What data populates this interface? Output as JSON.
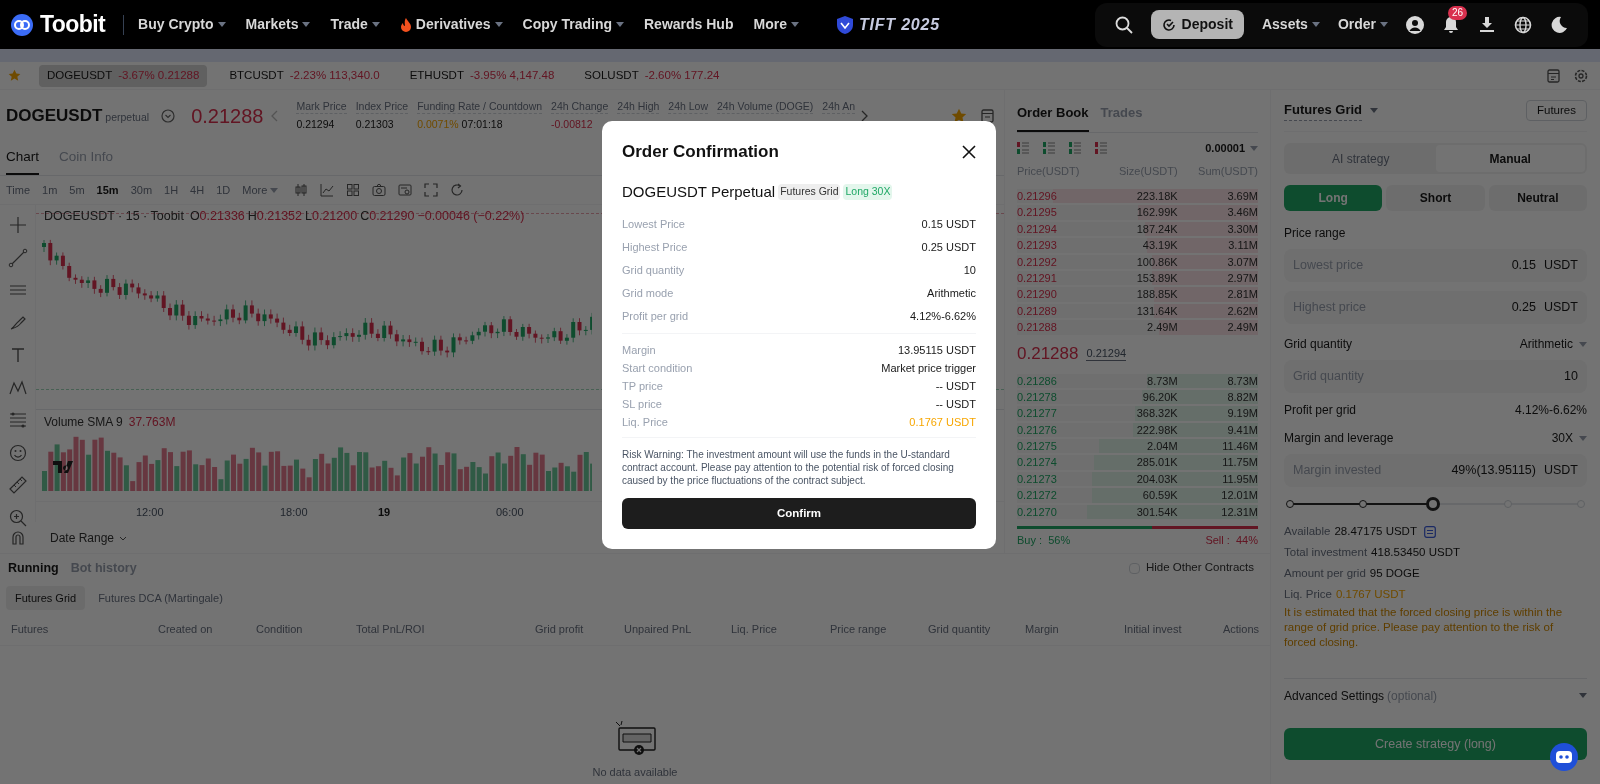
{
  "nav": {
    "brand": "Toobit",
    "items": [
      {
        "label": "Buy Crypto",
        "dropdown": true,
        "hot": false
      },
      {
        "label": "Markets",
        "dropdown": true,
        "hot": false
      },
      {
        "label": "Trade",
        "dropdown": true,
        "hot": false
      },
      {
        "label": "Derivatives",
        "dropdown": true,
        "hot": true
      },
      {
        "label": "Copy Trading",
        "dropdown": true,
        "hot": false
      },
      {
        "label": "Rewards Hub",
        "dropdown": false,
        "hot": false
      },
      {
        "label": "More",
        "dropdown": true,
        "hot": false
      }
    ],
    "event_logo": "TIFT 2025",
    "deposit": "Deposit",
    "menus": [
      {
        "label": "Assets"
      },
      {
        "label": "Order"
      }
    ],
    "notification_count": "26"
  },
  "tickers": [
    {
      "symbol": "DOGEUSDT",
      "change": "-3.67%",
      "price": "0.21288",
      "selected": true
    },
    {
      "symbol": "BTCUSDT",
      "change": "-2.23%",
      "price": "113,340.0",
      "selected": false
    },
    {
      "symbol": "ETHUSDT",
      "change": "-3.95%",
      "price": "4,147.48",
      "selected": false
    },
    {
      "symbol": "SOLUSDT",
      "change": "-2.60%",
      "price": "177.24",
      "selected": false
    }
  ],
  "symbol_header": {
    "symbol": "DOGEUSDT",
    "type": "perpetual",
    "price": "0.21288",
    "stats": [
      {
        "label": "Mark Price",
        "values": [
          {
            "text": "0.21294",
            "kind": "plain"
          }
        ]
      },
      {
        "label": "Index Price",
        "values": [
          {
            "text": "0.21303",
            "kind": "plain"
          }
        ]
      },
      {
        "label": "Funding Rate / Countdown",
        "values": [
          {
            "text": "0.0071%",
            "kind": "warn"
          },
          {
            "text": "07:01:18",
            "kind": "plain"
          }
        ]
      },
      {
        "label": "24h Change",
        "values": [
          {
            "text": "-0.00812",
            "kind": "down"
          }
        ]
      },
      {
        "label": "24h High"
      },
      {
        "label": "24h Low"
      },
      {
        "label": "24h Volume (DOGE)"
      },
      {
        "label": "24h An"
      }
    ]
  },
  "chart_tabs": [
    {
      "label": "Chart",
      "selected": true
    },
    {
      "label": "Coin Info",
      "selected": false
    }
  ],
  "intervals": [
    {
      "label": "Time",
      "selected": false
    },
    {
      "label": "1m",
      "selected": false
    },
    {
      "label": "5m",
      "selected": false
    },
    {
      "label": "15m",
      "selected": true
    },
    {
      "label": "30m",
      "selected": false
    },
    {
      "label": "1H",
      "selected": false
    },
    {
      "label": "4H",
      "selected": false
    },
    {
      "label": "1D",
      "selected": false
    }
  ],
  "more_intervals": "More",
  "chart": {
    "legend_title": "DOGEUSDT · 15 · Toobit",
    "ohlc": [
      {
        "key": "O",
        "value": "0.21336"
      },
      {
        "key": "H",
        "value": "0.21352"
      },
      {
        "key": "L",
        "value": "0.21200"
      },
      {
        "key": "C",
        "value": "0.21290"
      }
    ],
    "change": "−0.00046 (−0.22%)",
    "volume_label": "Volume SMA 9",
    "volume_value": "37.763M",
    "time_labels": [
      {
        "label": "12:00",
        "day": false
      },
      {
        "label": "18:00",
        "day": false
      },
      {
        "label": "19",
        "day": true
      },
      {
        "label": "06:00",
        "day": false
      }
    ],
    "date_range": "Date Range"
  },
  "order_book": {
    "tabs": [
      {
        "label": "Order Book",
        "selected": true
      },
      {
        "label": "Trades",
        "selected": false
      }
    ],
    "precision": "0.00001",
    "columns": [
      "Price(USDT)",
      "Size(USDT)",
      "Sum(USDT)"
    ],
    "asks": [
      {
        "price": "0.21296",
        "size": "223.18K",
        "sum": "3.69M",
        "level": 0.85
      },
      {
        "price": "0.21295",
        "size": "162.99K",
        "sum": "3.46M",
        "level": 0.5
      },
      {
        "price": "0.21294",
        "size": "187.24K",
        "sum": "3.30M",
        "level": 0.47
      },
      {
        "price": "0.21293",
        "size": "43.19K",
        "sum": "3.11M",
        "level": 0.46
      },
      {
        "price": "0.21292",
        "size": "100.86K",
        "sum": "3.07M",
        "level": 0.44
      },
      {
        "price": "0.21291",
        "size": "153.89K",
        "sum": "2.97M",
        "level": 0.44
      },
      {
        "price": "0.21290",
        "size": "188.85K",
        "sum": "2.81M",
        "level": 0.43
      },
      {
        "price": "0.21289",
        "size": "131.64K",
        "sum": "2.62M",
        "level": 0.43
      },
      {
        "price": "0.21288",
        "size": "2.49M",
        "sum": "2.49M",
        "level": 0.41
      }
    ],
    "last_price": "0.21288",
    "mark_price": "0.21294",
    "bids": [
      {
        "price": "0.21286",
        "size": "8.73M",
        "sum": "8.73M",
        "level": 0.46
      },
      {
        "price": "0.21278",
        "size": "96.20K",
        "sum": "8.82M",
        "level": 0.48
      },
      {
        "price": "0.21277",
        "size": "368.32K",
        "sum": "9.19M",
        "level": 0.51
      },
      {
        "price": "0.21276",
        "size": "222.98K",
        "sum": "9.41M",
        "level": 0.52
      },
      {
        "price": "0.21275",
        "size": "2.04M",
        "sum": "11.46M",
        "level": 0.66
      },
      {
        "price": "0.21274",
        "size": "285.01K",
        "sum": "11.75M",
        "level": 0.68
      },
      {
        "price": "0.21273",
        "size": "204.03K",
        "sum": "11.95M",
        "level": 0.69
      },
      {
        "price": "0.21272",
        "size": "60.59K",
        "sum": "12.01M",
        "level": 0.69
      },
      {
        "price": "0.21270",
        "size": "301.54K",
        "sum": "12.31M",
        "level": 0.71
      }
    ],
    "balance": {
      "level": 0.56,
      "buy": "Buy :  56%",
      "sell": "Sell :  44%"
    }
  },
  "bots": {
    "tabs": [
      {
        "label": "Running",
        "selected": true
      },
      {
        "label": "Bot history",
        "selected": false
      }
    ],
    "hide_other": {
      "label": "Hide Other Contracts",
      "checked": false
    },
    "sub_tabs": [
      {
        "label": "Futures Grid",
        "selected": true
      },
      {
        "label": "Futures DCA (Martingale)",
        "selected": false
      }
    ],
    "columns": [
      "Futures",
      "Created on",
      "Condition",
      "Total PnL/ROI",
      "Grid profit",
      "Unpaired PnL",
      "Liq. Price",
      "Price range",
      "Grid quantity",
      "Margin",
      "Initial invest",
      "Actions"
    ],
    "empty": "No data available"
  },
  "strategy_panel": {
    "title": "Futures Grid",
    "market_button": "Futures",
    "modes": [
      {
        "label": "AI strategy",
        "selected": false
      },
      {
        "label": "Manual",
        "selected": true
      }
    ],
    "directions": [
      {
        "label": "Long",
        "selected": true
      },
      {
        "label": "Short",
        "selected": false
      },
      {
        "label": "Neutral",
        "selected": false
      }
    ],
    "price_range_label": "Price range",
    "price_fields": [
      {
        "placeholder": "Lowest price",
        "value": "0.15",
        "unit": "USDT"
      },
      {
        "placeholder": "Highest price",
        "value": "0.25",
        "unit": "USDT"
      }
    ],
    "grid_label": "Grid quantity",
    "grid_mode": "Arithmetic",
    "grid_field": {
      "placeholder": "Grid quantity",
      "value": "10"
    },
    "profit_label": "Profit per grid",
    "profit_value": "4.12%-6.62%",
    "margin_label": "Margin and leverage",
    "leverage": "30X",
    "margin_field": {
      "placeholder": "Margin invested",
      "value": "49%(13.95115)",
      "unit": "USDT"
    },
    "margin_slider": {
      "level": 0.49
    },
    "summary": [
      {
        "label": "Available",
        "value": "28.47175 USDT",
        "kind": "plain",
        "transfer": true
      },
      {
        "label": "Total investment",
        "value": "418.53450 USDT",
        "kind": "plain",
        "transfer": false
      },
      {
        "label": "Amount per grid",
        "value": "95 DOGE",
        "kind": "plain",
        "transfer": false
      },
      {
        "label": "Liq. Price",
        "value": "0.1767 USDT",
        "kind": "warn",
        "transfer": false
      }
    ],
    "liq_warning": "It is estimated that the forced closing price is within the range of grid price. Please pay attention to the risk of forced closing.",
    "advanced": "Advanced Settings",
    "advanced_note": "(optional)",
    "create": "Create strategy (long)"
  },
  "modal": {
    "title": "Order Confirmation",
    "symbol": "DOGEUSDT Perpetual",
    "tags": [
      {
        "label": "Futures Grid",
        "kind": "neutral"
      },
      {
        "label": "Long 30X",
        "kind": "long"
      }
    ],
    "groups": [
      [
        {
          "label": "Lowest Price",
          "value": "0.15 USDT",
          "kind": "plain"
        },
        {
          "label": "Highest Price",
          "value": "0.25 USDT",
          "kind": "plain"
        },
        {
          "label": "Grid quantity",
          "value": "10",
          "kind": "plain"
        },
        {
          "label": "Grid mode",
          "value": "Arithmetic",
          "kind": "plain"
        },
        {
          "label": "Profit per grid",
          "value": "4.12%-6.62%",
          "kind": "plain"
        }
      ],
      [
        {
          "label": "Margin",
          "value": "13.95115 USDT",
          "kind": "plain"
        },
        {
          "label": "Start condition",
          "value": "Market price trigger",
          "kind": "plain"
        },
        {
          "label": "TP price",
          "value": "-- USDT",
          "kind": "plain"
        },
        {
          "label": "SL price",
          "value": "-- USDT",
          "kind": "plain"
        },
        {
          "label": "Liq. Price",
          "value": "0.1767 USDT",
          "kind": "warn"
        }
      ]
    ],
    "warning": "Risk Warning: The investment amount will use the funds in the U-standard contract account. Please pay attention to the potential risk of forced closing caused by the price fluctuations of the contract subject.",
    "confirm": "Confirm"
  }
}
